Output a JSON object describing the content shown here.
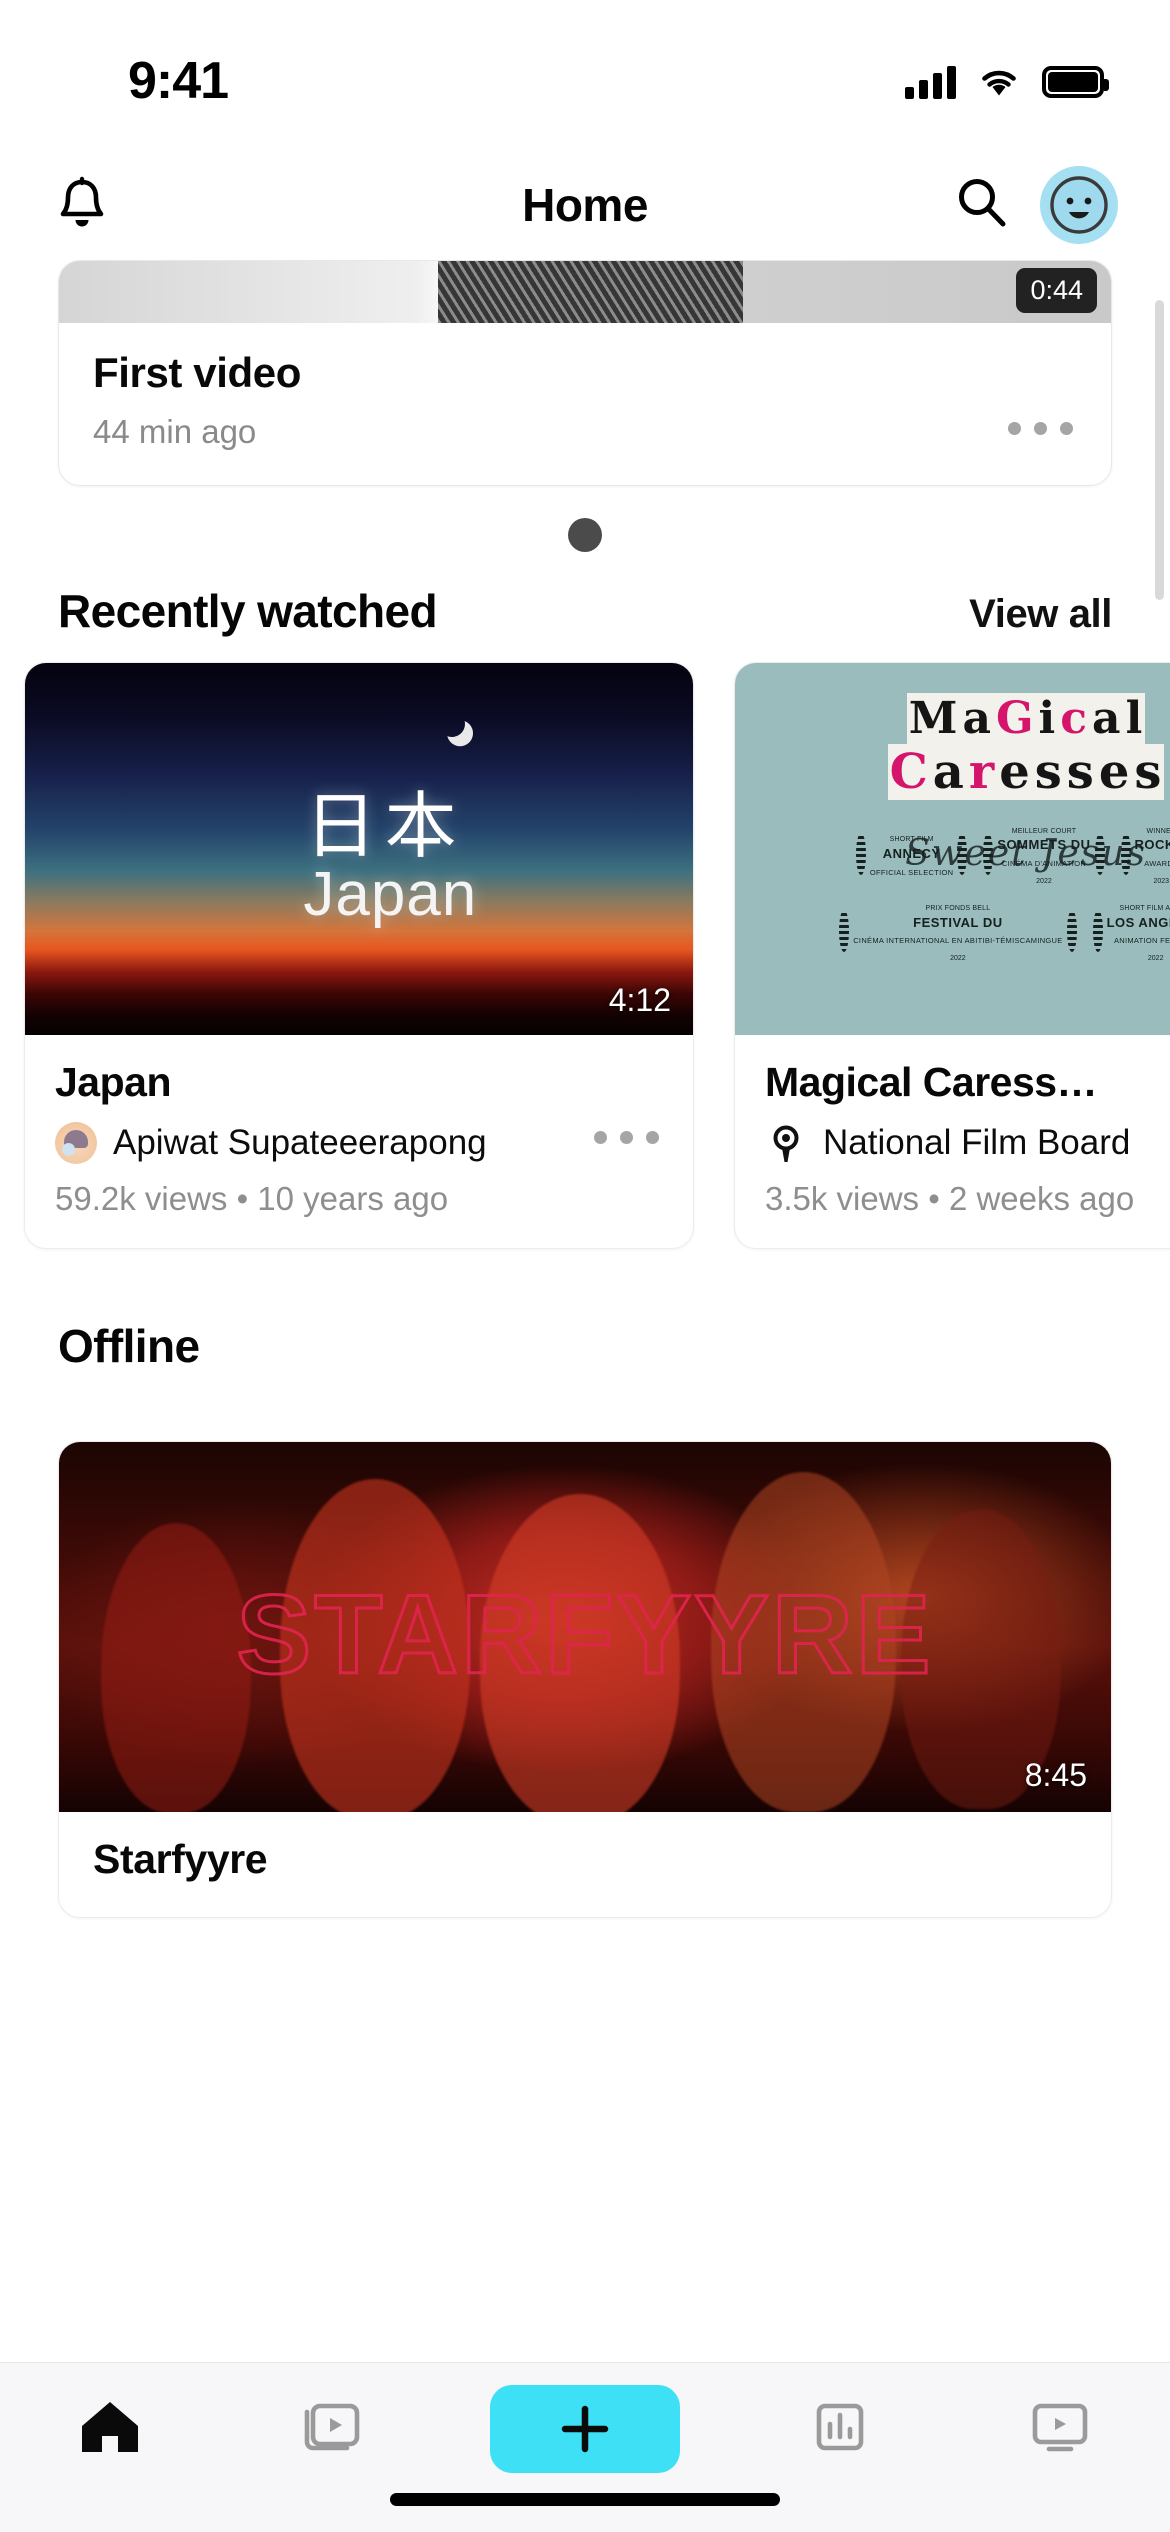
{
  "status_bar": {
    "time": "9:41",
    "signal_icon": "cellular-signal-icon",
    "wifi_icon": "wifi-icon",
    "battery_icon": "battery-icon"
  },
  "header": {
    "title": "Home",
    "bell_icon": "bell-icon",
    "search_icon": "search-icon",
    "avatar_icon": "avatar-smiley-icon",
    "avatar_bg": "#a5dff2"
  },
  "featured_card": {
    "title": "First video",
    "subtitle": "44 min ago",
    "duration": "0:44",
    "more_icon": "more-options-icon"
  },
  "sections": [
    {
      "title": "Recently watched",
      "action_label": "View all",
      "cards": [
        {
          "title": "Japan",
          "channel": "Apiwat Supateeerapong",
          "meta": "59.2k views • 10 years ago",
          "duration": "4:12",
          "thumb_kanji": "日本",
          "thumb_latin": "Japan"
        },
        {
          "title": "Magical Caress…",
          "channel": "National Film Board",
          "meta": "3.5k views • 2 weeks ago",
          "duration": "",
          "poster_line1": "MaGical",
          "poster_line2": "Caresses",
          "poster_script": "Sweet Jesus",
          "laurels": [
            {
              "top": "SHORT FILM",
              "mid": "ANNECY",
              "bot": "OFFICIAL SELECTION",
              "year": ""
            },
            {
              "top": "MEILLEUR COURT",
              "mid": "SOMMETS DU",
              "bot": "CINÉMA D'ANIMATION",
              "year": "2022"
            },
            {
              "top": "WINNER",
              "mid": "ROCKIE",
              "bot": "AWARDS",
              "year": "2023"
            },
            {
              "top": "PRIX FONDS BELL",
              "mid": "FESTIVAL DU",
              "bot": "CINÉMA INTERNATIONAL EN ABITIBI-TÉMISCAMINGUE",
              "year": "2022"
            },
            {
              "top": "SHORT FILM AWARD",
              "mid": "LOS ANGELES",
              "bot": "ANIMATION FESTIVAL",
              "year": "2022"
            }
          ]
        }
      ]
    },
    {
      "title": "Offline",
      "action_label": "",
      "cards": [
        {
          "title": "Starfyyre",
          "duration": "8:45",
          "thumb_word": "STARFYYRE"
        }
      ]
    }
  ],
  "tabbar": {
    "items": [
      {
        "icon": "home-icon",
        "active": true
      },
      {
        "icon": "library-stack-icon",
        "active": false
      },
      {
        "icon": "plus-icon",
        "active": false
      },
      {
        "icon": "analytics-bar-chart-icon",
        "active": false
      },
      {
        "icon": "video-monitor-icon",
        "active": false
      }
    ],
    "accent_color": "#3ee0f5"
  }
}
